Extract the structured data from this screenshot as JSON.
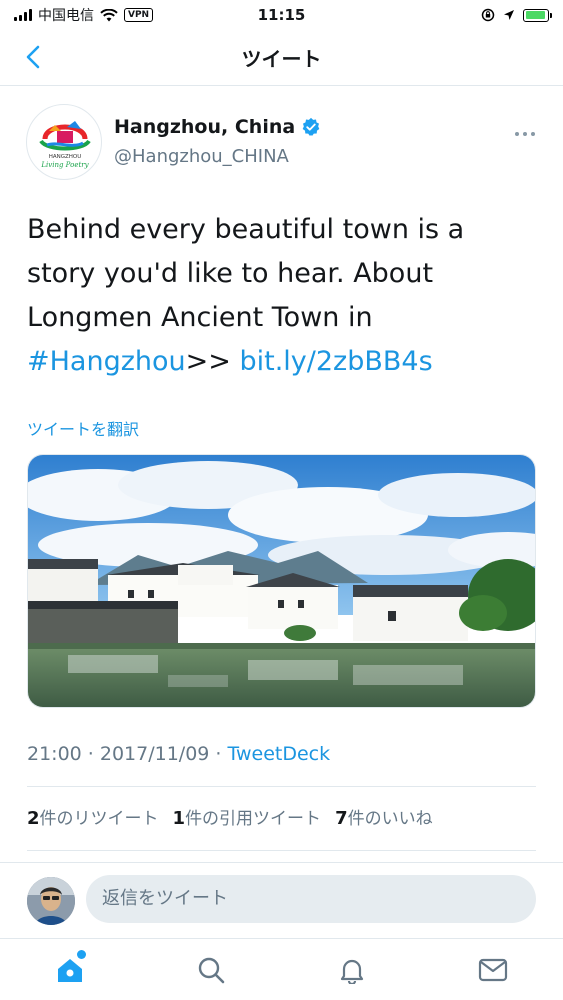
{
  "status_bar": {
    "carrier": "中国电信",
    "vpn": "VPN",
    "time": "11:15"
  },
  "nav": {
    "title": "ツイート"
  },
  "tweet": {
    "author_name": "Hangzhou, China",
    "author_handle": "@Hangzhou_CHINA",
    "logo_text_line1": "HANGZHOU",
    "logo_text_line2": "Living Poetry",
    "text_part1": "Behind every beautiful town is a story you'd like to hear. About Longmen Ancient Town in ",
    "hashtag": "#Hangzhou",
    "text_part2": ">> ",
    "link": "bit.ly/2zbBB4s",
    "translate_label": "ツイートを翻訳",
    "timestamp": "21:00 · 2017/11/09 · ",
    "via": "TweetDeck",
    "retweets_count": "2",
    "retweets_label": "件のリツイート",
    "quotes_count": "1",
    "quotes_label": "件の引用ツイート",
    "likes_count": "7",
    "likes_label": "件のいいね"
  },
  "reply": {
    "placeholder": "返信をツイート"
  },
  "colors": {
    "accent": "#1da1f2",
    "link": "#1b95e0",
    "muted": "#657786"
  },
  "icons": [
    "back-chevron-icon",
    "verified-badge-icon",
    "more-icon",
    "home-icon",
    "search-icon",
    "bell-icon",
    "mail-icon"
  ]
}
